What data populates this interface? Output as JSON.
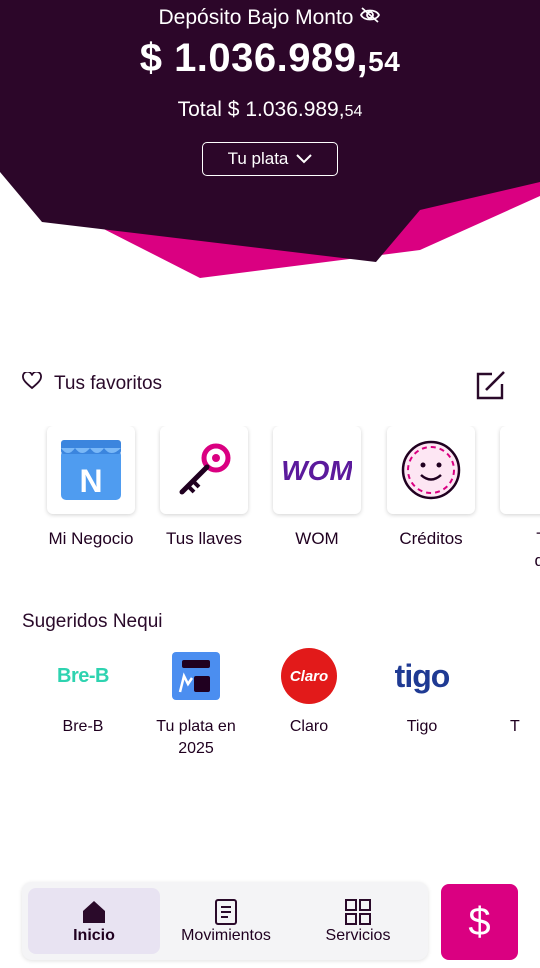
{
  "header": {
    "deposit_title": "Depósito Bajo Monto",
    "balance_main": "$ 1.036.989,",
    "balance_cents": "54",
    "total_main": "Total $ 1.036.989,",
    "total_cents": "54",
    "plata_button": "Tu plata",
    "colors": {
      "dark": "#2c0629",
      "accent": "#da0081"
    }
  },
  "favorites": {
    "title": "Tus favoritos",
    "items": [
      {
        "label": "Mi Negocio",
        "icon": "store-n-icon"
      },
      {
        "label": "Tus llaves",
        "icon": "key-icon"
      },
      {
        "label": "WOM",
        "icon": "wom-logo"
      },
      {
        "label": "Créditos",
        "icon": "smiley-coin-icon"
      },
      {
        "label": "Tr",
        "label2": "de",
        "icon": "partial-icon"
      }
    ]
  },
  "suggested": {
    "title": "Sugeridos Nequi",
    "items": [
      {
        "label": "Bre-B",
        "logo_text": "Bre-B",
        "icon": "bre-b-logo"
      },
      {
        "label": "Tu plata en 2025",
        "icon": "tu-plata-2025-icon"
      },
      {
        "label": "Claro",
        "logo_text": "Claro",
        "icon": "claro-logo"
      },
      {
        "label": "Tigo",
        "logo_text": "tigo",
        "icon": "tigo-logo"
      },
      {
        "label": "T",
        "icon": "partial-icon"
      }
    ]
  },
  "bottom_nav": {
    "items": [
      {
        "label": "Inicio",
        "icon": "home-icon",
        "active": true
      },
      {
        "label": "Movimientos",
        "icon": "document-icon",
        "active": false
      },
      {
        "label": "Servicios",
        "icon": "grid-icon",
        "active": false
      }
    ],
    "pay_icon": "dollar-icon",
    "pay_symbol": "$"
  }
}
